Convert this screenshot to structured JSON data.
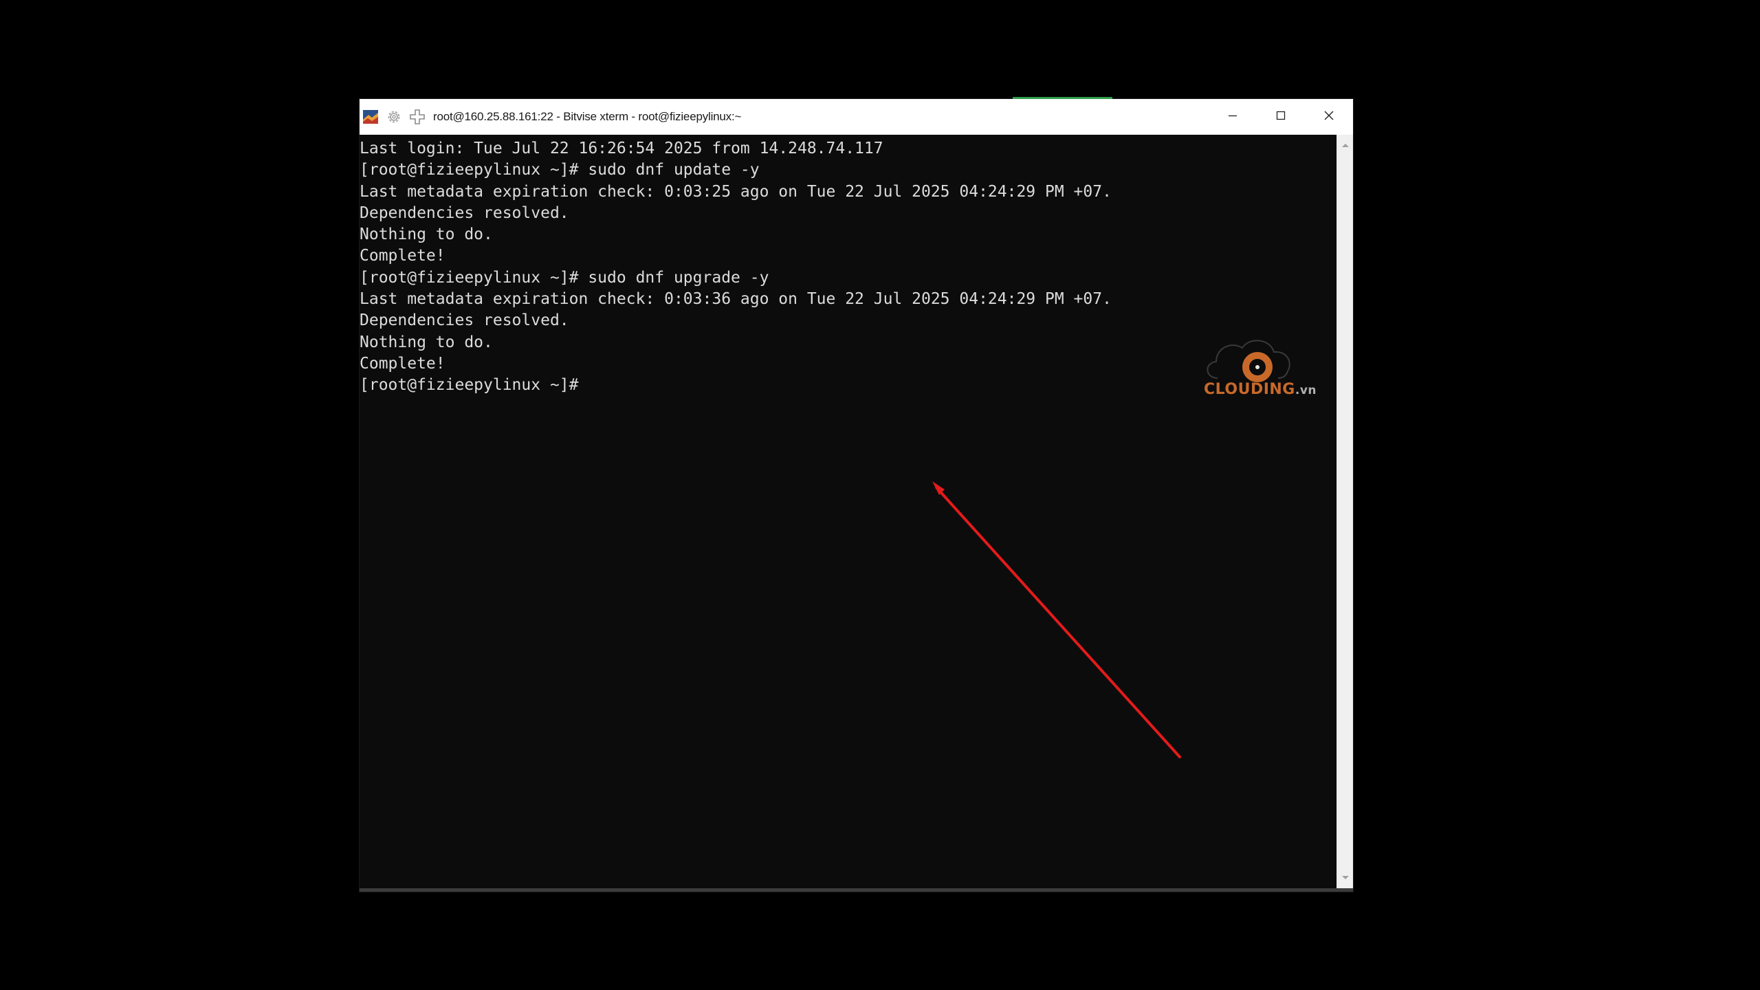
{
  "window": {
    "title": "root@160.25.88.161:22 - Bitvise xterm - root@fizieepylinux:~",
    "icons": [
      "bitvise-app-icon",
      "gear-icon",
      "move-icon"
    ],
    "controls": [
      "minimize-icon",
      "maximize-icon",
      "close-icon"
    ]
  },
  "terminal": {
    "lines": [
      "Last login: Tue Jul 22 16:26:54 2025 from 14.248.74.117",
      "[root@fizieepylinux ~]# sudo dnf update -y",
      "Last metadata expiration check: 0:03:25 ago on Tue 22 Jul 2025 04:24:29 PM +07.",
      "Dependencies resolved.",
      "Nothing to do.",
      "Complete!",
      "[root@fizieepylinux ~]# sudo dnf upgrade -y",
      "Last metadata expiration check: 0:03:36 ago on Tue 22 Jul 2025 04:24:29 PM +07.",
      "Dependencies resolved.",
      "Nothing to do.",
      "Complete!",
      "[root@fizieepylinux ~]#"
    ]
  },
  "watermark": {
    "brand": "CLOUDING",
    "tld": ".vn"
  },
  "annotation": {
    "arrow_color": "#e31b1b"
  },
  "colors": {
    "terminal_bg": "#0c0c0c",
    "terminal_text": "#dcdcdc",
    "titlebar_bg": "#ffffff",
    "logo_orange": "#c8692a"
  }
}
